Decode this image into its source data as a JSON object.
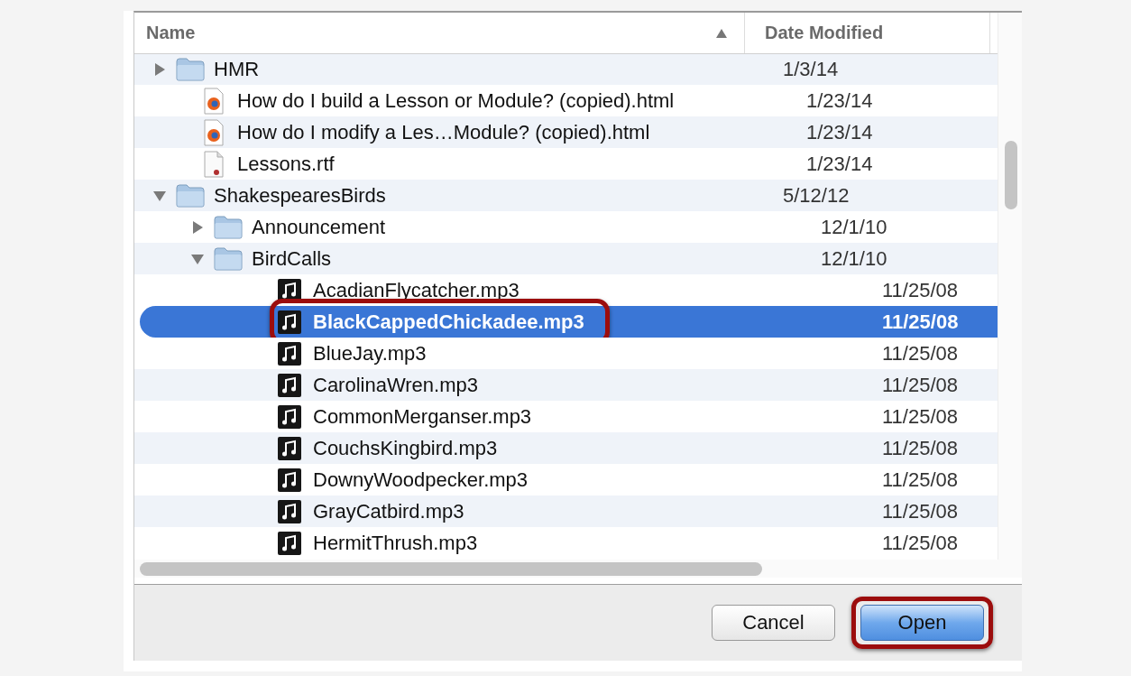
{
  "columns": [
    {
      "label": "Name",
      "sorted": true
    },
    {
      "label": "Date Modified",
      "sorted": false
    }
  ],
  "items": [
    {
      "name": "HMR",
      "date": "1/3/14",
      "kind": "folder",
      "expanded": false,
      "selected": false,
      "highlighted": false
    },
    {
      "name": "How do I build a Lesson or Module? (copied).html",
      "date": "1/23/14",
      "kind": "html",
      "selected": false,
      "highlighted": false
    },
    {
      "name": "How do I modify a Les…Module? (copied).html",
      "date": "1/23/14",
      "kind": "html",
      "selected": false,
      "highlighted": false
    },
    {
      "name": "Lessons.rtf",
      "date": "1/23/14",
      "kind": "rtf",
      "selected": false,
      "highlighted": false
    },
    {
      "name": "ShakespearesBirds",
      "date": "5/12/12",
      "kind": "folder",
      "expanded": true,
      "selected": false,
      "highlighted": false,
      "children": [
        {
          "name": "Announcement",
          "date": "12/1/10",
          "kind": "folder",
          "expanded": false,
          "selected": false,
          "highlighted": false
        },
        {
          "name": "BirdCalls",
          "date": "12/1/10",
          "kind": "folder",
          "expanded": true,
          "selected": false,
          "highlighted": false,
          "children": [
            {
              "name": "AcadianFlycatcher.mp3",
              "date": "11/25/08",
              "kind": "audio",
              "selected": false,
              "highlighted": false
            },
            {
              "name": "BlackCappedChickadee.mp3",
              "date": "11/25/08",
              "kind": "audio",
              "selected": true,
              "highlighted": true
            },
            {
              "name": "BlueJay.mp3",
              "date": "11/25/08",
              "kind": "audio",
              "selected": false,
              "highlighted": false
            },
            {
              "name": "CarolinaWren.mp3",
              "date": "11/25/08",
              "kind": "audio",
              "selected": false,
              "highlighted": false
            },
            {
              "name": "CommonMerganser.mp3",
              "date": "11/25/08",
              "kind": "audio",
              "selected": false,
              "highlighted": false
            },
            {
              "name": "CouchsKingbird.mp3",
              "date": "11/25/08",
              "kind": "audio",
              "selected": false,
              "highlighted": false
            },
            {
              "name": "DownyWoodpecker.mp3",
              "date": "11/25/08",
              "kind": "audio",
              "selected": false,
              "highlighted": false
            },
            {
              "name": "GrayCatbird.mp3",
              "date": "11/25/08",
              "kind": "audio",
              "selected": false,
              "highlighted": false
            },
            {
              "name": "HermitThrush.mp3",
              "date": "11/25/08",
              "kind": "audio",
              "selected": false,
              "highlighted": false
            }
          ]
        }
      ]
    }
  ],
  "buttons": [
    {
      "label": "Cancel",
      "default": false,
      "highlighted": false
    },
    {
      "label": "Open",
      "default": true,
      "highlighted": true
    }
  ]
}
